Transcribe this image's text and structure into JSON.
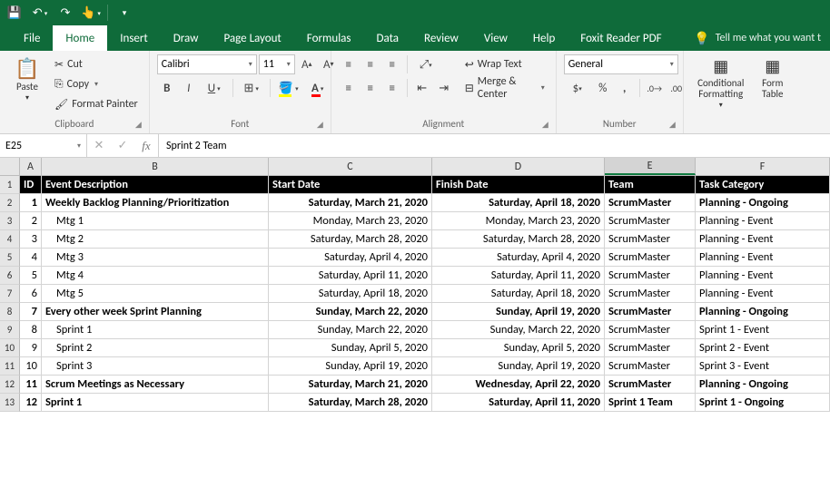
{
  "titlebar": {
    "save_icon": "💾",
    "undo_icon": "↶",
    "redo_icon": "↷",
    "touch_icon": "👆"
  },
  "tabs": {
    "file": "File",
    "home": "Home",
    "insert": "Insert",
    "draw": "Draw",
    "page_layout": "Page Layout",
    "formulas": "Formulas",
    "data": "Data",
    "review": "Review",
    "view": "View",
    "help": "Help",
    "foxit": "Foxit Reader PDF",
    "tell_me": "Tell me what you want t"
  },
  "ribbon": {
    "clipboard": {
      "paste": "Paste",
      "cut": "Cut",
      "copy": "Copy",
      "format_painter": "Format Painter",
      "label": "Clipboard"
    },
    "font": {
      "name": "Calibri",
      "size": "11",
      "label": "Font"
    },
    "alignment": {
      "wrap": "Wrap Text",
      "merge": "Merge & Center",
      "label": "Alignment"
    },
    "number": {
      "format": "General",
      "label": "Number"
    },
    "styles": {
      "conditional": "Conditional Formatting",
      "format_table": "Form Table"
    }
  },
  "formula_bar": {
    "name_box": "E25",
    "formula": "Sprint 2 Team"
  },
  "columns": [
    "A",
    "B",
    "C",
    "D",
    "E",
    "F"
  ],
  "headers": {
    "id": "ID",
    "desc": "Event Description",
    "start": "Start Date",
    "finish": "Finish Date",
    "team": "Team",
    "cat": "Task Category"
  },
  "chart_data": {
    "type": "table",
    "columns": [
      "ID",
      "Event Description",
      "Start Date",
      "Finish Date",
      "Team",
      "Task Category"
    ],
    "rows": [
      {
        "id": "1",
        "desc": "Weekly Backlog Planning/Prioritization",
        "start": "Saturday, March 21, 2020",
        "finish": "Saturday, April 18, 2020",
        "team": "ScrumMaster",
        "cat": "Planning - Ongoing",
        "bold": true
      },
      {
        "id": "2",
        "desc": "Mtg 1",
        "start": "Monday, March 23, 2020",
        "finish": "Monday, March 23, 2020",
        "team": "ScrumMaster",
        "cat": "Planning - Event",
        "bold": false
      },
      {
        "id": "3",
        "desc": "Mtg 2",
        "start": "Saturday, March 28, 2020",
        "finish": "Saturday, March 28, 2020",
        "team": "ScrumMaster",
        "cat": "Planning - Event",
        "bold": false
      },
      {
        "id": "4",
        "desc": "Mtg 3",
        "start": "Saturday, April 4, 2020",
        "finish": "Saturday, April 4, 2020",
        "team": "ScrumMaster",
        "cat": "Planning - Event",
        "bold": false
      },
      {
        "id": "5",
        "desc": "Mtg 4",
        "start": "Saturday, April 11, 2020",
        "finish": "Saturday, April 11, 2020",
        "team": "ScrumMaster",
        "cat": "Planning - Event",
        "bold": false
      },
      {
        "id": "6",
        "desc": "Mtg 5",
        "start": "Saturday, April 18, 2020",
        "finish": "Saturday, April 18, 2020",
        "team": "ScrumMaster",
        "cat": "Planning - Event",
        "bold": false
      },
      {
        "id": "7",
        "desc": "Every other week Sprint Planning",
        "start": "Sunday, March 22, 2020",
        "finish": "Sunday, April 19, 2020",
        "team": "ScrumMaster",
        "cat": "Planning - Ongoing",
        "bold": true
      },
      {
        "id": "8",
        "desc": "Sprint 1",
        "start": "Sunday, March 22, 2020",
        "finish": "Sunday, March 22, 2020",
        "team": "ScrumMaster",
        "cat": "Sprint 1 - Event",
        "bold": false
      },
      {
        "id": "9",
        "desc": "Sprint 2",
        "start": "Sunday, April 5, 2020",
        "finish": "Sunday, April 5, 2020",
        "team": "ScrumMaster",
        "cat": "Sprint 2 - Event",
        "bold": false
      },
      {
        "id": "10",
        "desc": "Sprint 3",
        "start": "Sunday, April 19, 2020",
        "finish": "Sunday, April 19, 2020",
        "team": "ScrumMaster",
        "cat": "Sprint 3 - Event",
        "bold": false
      },
      {
        "id": "11",
        "desc": "Scrum Meetings as Necessary",
        "start": "Saturday, March 21, 2020",
        "finish": "Wednesday, April 22, 2020",
        "team": "ScrumMaster",
        "cat": "Planning - Ongoing",
        "bold": true
      },
      {
        "id": "12",
        "desc": "Sprint 1",
        "start": "Saturday, March 28, 2020",
        "finish": "Saturday, April 11, 2020",
        "team": "Sprint 1 Team",
        "cat": "Sprint 1 - Ongoing",
        "bold": true
      }
    ]
  }
}
